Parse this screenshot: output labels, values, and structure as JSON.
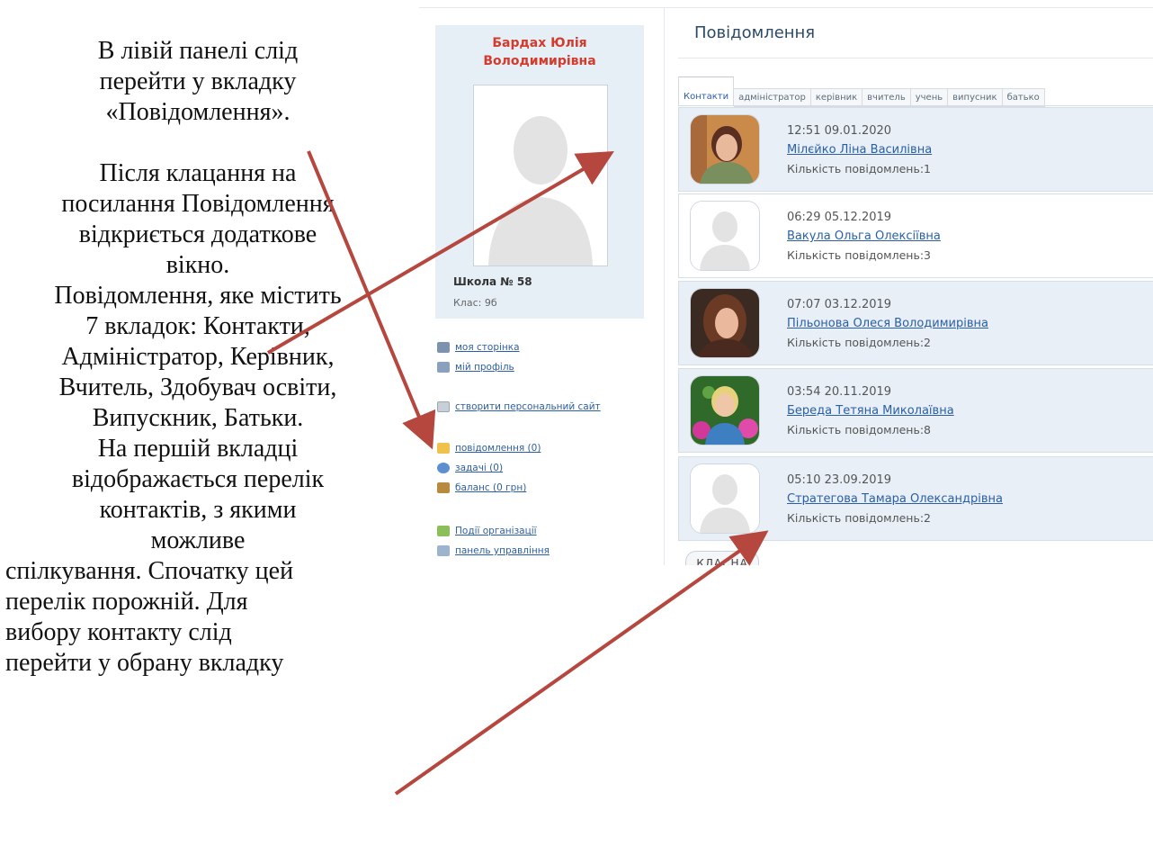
{
  "doc": {
    "p1_line1": "В лівій панелі слід",
    "p1_line2": "перейти у вкладку",
    "p1_line3": "«Повідомлення».",
    "p2_line1": "Після клацання на",
    "p2_line2": "посилання Повідомлення",
    "p2_line3": "відкриється додаткове",
    "p2_line4": "вікно.",
    "p2_line5": "Повідомлення, яке містить",
    "p2_line6": "7 вкладок: Контакти,",
    "p2_line7": "Адміністратор, Керівник,",
    "p2_line8": "Вчитель, Здобувач освіти,",
    "p2_line9": "Випускник, Батьки.",
    "p2_line10": "На першій вкладці",
    "p2_line11": "відображається перелік",
    "p2_line12": "контактів, з якими",
    "p2_line13": "можливе",
    "p3_line1": "спілкування. Спочатку цей",
    "p3_line2": "перелік порожній. Для",
    "p3_line3": "вибору контакту слід",
    "p3_line4": "перейти у обрану вкладку"
  },
  "profile": {
    "name_line1": "Бардах Юлія",
    "name_line2": "Володимирівна",
    "school": "Школа № 58",
    "class": "Клас: 9б"
  },
  "menu": {
    "my_page": "моя сторінка",
    "my_profile": "мій профіль",
    "create_site": "створити персональний сайт",
    "messages": "повідомлення (0)",
    "tasks": "задачі (0)",
    "balance": "баланс (0 грн)",
    "org_events": "Події організації",
    "control_panel": "панель управління"
  },
  "messages": {
    "title": "Повідомлення",
    "tabs": [
      "Контакти",
      "адміністратор",
      "керівник",
      "вчитель",
      "учень",
      "випусник",
      "батько"
    ],
    "contacts": [
      {
        "time": "12:51 09.01.2020",
        "name": "Мілєйко Ліна Василівна",
        "count": "Кількість повідомлень:1"
      },
      {
        "time": "06:29 05.12.2019",
        "name": "Вакула Ольга Олексіївна",
        "count": "Кількість повідомлень:3"
      },
      {
        "time": "07:07 03.12.2019",
        "name": "Пільонова Олеся Володимирівна",
        "count": "Кількість повідомлень:2"
      },
      {
        "time": "03:54 20.11.2019",
        "name": "Береда Тетяна Миколаївна",
        "count": "Кількість повідомлень:8"
      },
      {
        "time": "05:10 23.09.2019",
        "name": "Стратегова Тамара Олександрівна",
        "count": "Кількість повідомлень:2"
      }
    ],
    "more_label": "КЛАСНА"
  },
  "colors": {
    "arrow": "#b5473f",
    "accent_name": "#d33b2c",
    "link": "#2a5fa6"
  }
}
